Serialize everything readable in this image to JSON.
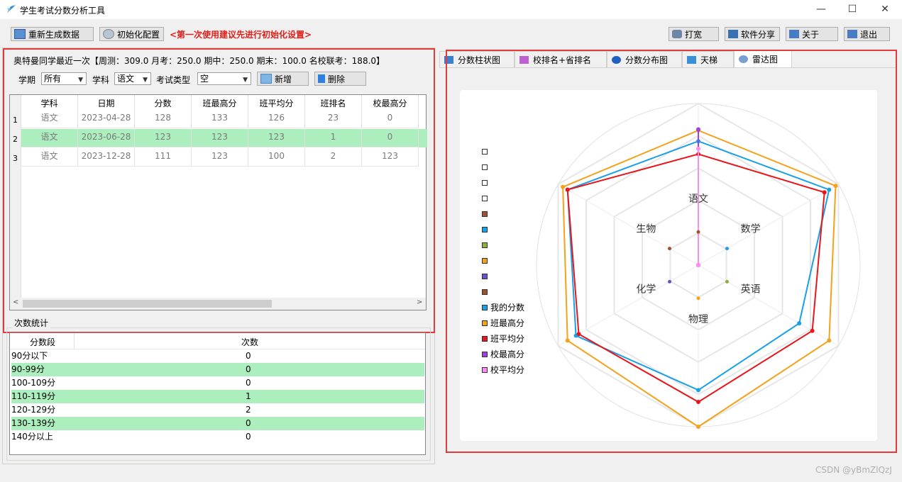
{
  "window": {
    "title": "学生考试分数分析工具",
    "minimize": "—",
    "maximize": "☐",
    "close": "✕"
  },
  "toolbar": {
    "regenerate": "重新生成数据",
    "init_config": "初始化配置",
    "hint": "<第一次使用建议先进行初始化设置>",
    "print": "打宽",
    "share": "软件分享",
    "about": "关于",
    "exit": "退出"
  },
  "summary": "奥特曼同学最近一次【周测：309.0 月考：250.0 期中：250.0 期末：100.0 名校联考：188.0】",
  "filters": {
    "term_label": "学期",
    "term_value": "所有",
    "subject_label": "学科",
    "subject_value": "语文",
    "exam_type_label": "考试类型",
    "exam_type_value": "空",
    "add_button": "新增",
    "delete_button": "删除"
  },
  "score_table": {
    "columns": [
      "学科",
      "日期",
      "分数",
      "班最高分",
      "班平均分",
      "班排名",
      "校最高分"
    ],
    "rows": [
      {
        "index": "1",
        "cells": [
          "语文",
          "2023-04-28",
          "128",
          "133",
          "126",
          "23",
          "0"
        ]
      },
      {
        "index": "2",
        "cells": [
          "语文",
          "2023-06-28",
          "123",
          "123",
          "123",
          "1",
          "0"
        ]
      },
      {
        "index": "3",
        "cells": [
          "语文",
          "2023-12-28",
          "111",
          "123",
          "100",
          "2",
          "123"
        ]
      }
    ],
    "highlighted_row": 2
  },
  "count_stats": {
    "group_title": "次数统计",
    "columns": [
      "分数段",
      "次数"
    ],
    "rows": [
      {
        "range": "90分以下",
        "count": "0",
        "highlight": false
      },
      {
        "range": "90-99分",
        "count": "0",
        "highlight": true
      },
      {
        "range": "100-109分",
        "count": "0",
        "highlight": false
      },
      {
        "range": "110-119分",
        "count": "1",
        "highlight": true
      },
      {
        "range": "120-129分",
        "count": "2",
        "highlight": false
      },
      {
        "range": "130-139分",
        "count": "0",
        "highlight": true
      },
      {
        "range": "140分以上",
        "count": "0",
        "highlight": false
      }
    ]
  },
  "tabs": [
    {
      "label": "分数柱状图",
      "icon": "bar-chart-icon",
      "active": false
    },
    {
      "label": "校排名+省排名",
      "icon": "line-chart-icon",
      "active": false
    },
    {
      "label": "分数分布图",
      "icon": "pie-chart-icon",
      "active": false
    },
    {
      "label": "天梯",
      "icon": "area-chart-icon",
      "active": false
    },
    {
      "label": "雷达图",
      "icon": "radar-chart-icon",
      "active": true
    }
  ],
  "chart_data": {
    "type": "radar",
    "axes": [
      "语文",
      "数学",
      "英语",
      "物理",
      "化学",
      "生物"
    ],
    "max": 150,
    "series": [
      {
        "name": "我的分数",
        "color": "#1aa0e8",
        "values": [
          115,
          140,
          108,
          116,
          131,
          140
        ]
      },
      {
        "name": "班最高分",
        "color": "#f4a11b",
        "values": [
          125,
          147,
          140,
          150,
          140,
          145
        ]
      },
      {
        "name": "班平均分",
        "color": "#e8161a",
        "values": [
          103,
          135,
          122,
          127,
          128,
          140
        ]
      },
      {
        "name": "校最高分",
        "color": "#a040e0",
        "values": [
          126,
          0,
          0,
          0,
          0,
          0
        ]
      },
      {
        "name": "校平均分",
        "color": "#ff8cf0",
        "values": [
          108,
          0,
          0,
          0,
          0,
          0
        ]
      }
    ],
    "extra_legend_colors": [
      "#ffffff",
      "#ffffff",
      "#ffffff",
      "#ffffff",
      "#a0522d",
      "#1aa0e8",
      "#8db03a",
      "#f4a11b",
      "#6a4fd0",
      "#a0522d"
    ],
    "axis_marker_colors": [
      "#a0522d",
      "#1aa0e8",
      "#8db03a",
      "#f4a11b",
      "#6a4fd0",
      "#a0522d"
    ],
    "legend_position": "left",
    "grid": true
  },
  "watermark": "CSDN @yBmZlQzJ"
}
